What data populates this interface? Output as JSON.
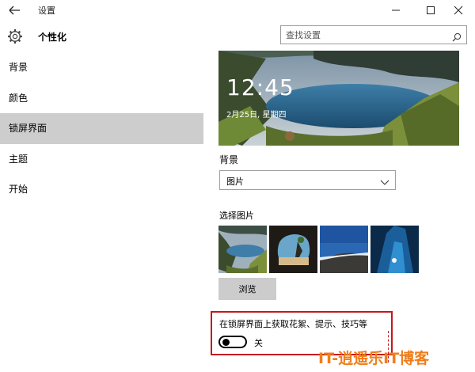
{
  "window": {
    "title": "设置",
    "controls": [
      "minimize-icon",
      "maximize-icon",
      "close-icon"
    ]
  },
  "header": {
    "title": "个性化",
    "search_placeholder": "查找设置"
  },
  "sidebar": {
    "items": [
      {
        "label": "背景"
      },
      {
        "label": "颜色"
      },
      {
        "label": "锁屏界面",
        "selected": true
      },
      {
        "label": "主题"
      },
      {
        "label": "开始"
      }
    ]
  },
  "lock_preview": {
    "time": "12:45",
    "date": "2月25日, 星期四"
  },
  "background": {
    "label": "背景",
    "selected": "图片"
  },
  "choose_picture": {
    "label": "选择图片",
    "browse_label": "浏览"
  },
  "spotlight": {
    "label": "在锁屏界面上获取花絮、提示、技巧等",
    "toggle_state": "关",
    "toggle_on": false
  },
  "colors": {
    "selected_item": "#cdcdcd",
    "highlight": "#c7181d",
    "watermark": "#f07e1b"
  },
  "watermark": {
    "text": "IT-逍遥乐IT博客"
  }
}
